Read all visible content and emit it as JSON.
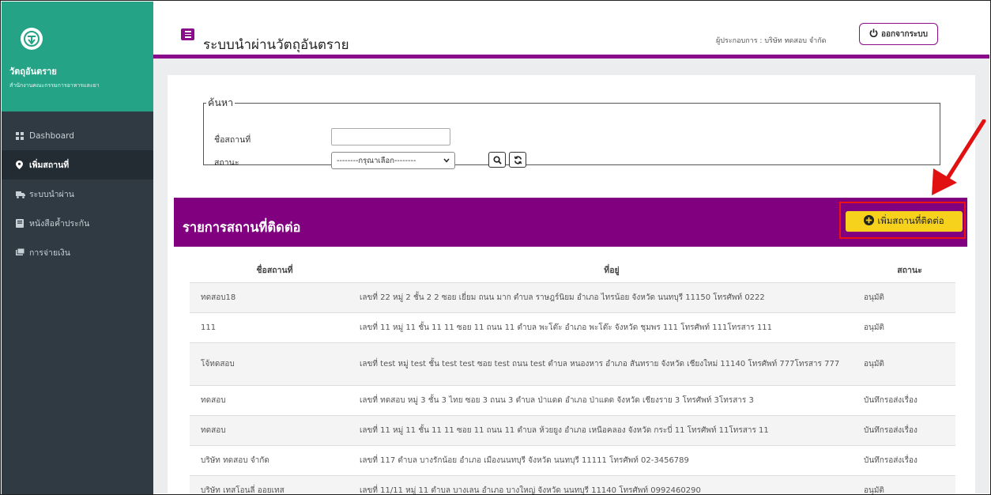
{
  "sidebar": {
    "brand_title": "วัตถุอันตราย",
    "brand_subtitle": "สำนักงานคณะกรรมการอาหารและยา",
    "items": [
      {
        "label": "Dashboard",
        "icon": "dashboard-icon"
      },
      {
        "label": "เพิ่มสถานที่",
        "icon": "map-marker-icon",
        "active": true
      },
      {
        "label": "ระบบนำผ่าน",
        "icon": "truck-icon"
      },
      {
        "label": "หนังสือค้ำประกัน",
        "icon": "book-icon"
      },
      {
        "label": "การจ่ายเงิน",
        "icon": "money-icon"
      }
    ]
  },
  "header": {
    "title": "ระบบนำผ่านวัตถุอันตราย",
    "operator": "ผู้ประกอบการ : บริษัท ทดสอบ จำกัด",
    "logout_label": "ออกจากระบบ"
  },
  "search": {
    "legend": "ค้นหา",
    "name_label": "ชื่อสถานที่",
    "name_value": "",
    "status_label": "สถานะ",
    "status_selected": "--------กรุณาเลือก--------"
  },
  "list": {
    "title": "รายการสถานที่ติดต่อ",
    "add_label": "เพิ่มสถานที่ติดต่อ",
    "columns": [
      "ชื่อสถานที่",
      "ที่อยู่",
      "สถานะ"
    ],
    "rows": [
      {
        "name": "ทดสอบ18",
        "address": "เลขที่ 22 หมู่ 2 ชั้น 2 2 ซอย เยี่ยม ถนน มาก ตำบล ราษฎร์นิยม อำเภอ ไทรน้อย จังหวัด นนทบุรี 11150 โทรศัพท์ 0222",
        "status": "อนุมัติ"
      },
      {
        "name": "111",
        "address": "เลขที่ 11 หมู่ 11 ชั้น 11 11 ซอย 11 ถนน 11 ตำบล พะโต๊ะ อำเภอ พะโต๊ะ จังหวัด ชุมพร 111 โทรศัพท์ 111โทรสาร 111",
        "status": "อนุมัติ"
      },
      {
        "name": "โจ้ทดสอบ",
        "address": "เลขที่ test หมู่ test ชั้น test test ซอย test ถนน test ตำบล หนองหาร อำเภอ สันทราย จังหวัด เชียงใหม่ 11140 โทรศัพท์ 777โทรสาร 777",
        "status": "อนุมัติ"
      },
      {
        "name": "ทดสอบ",
        "address": "เลขที่ ทดสอบ หมู่ 3 ชั้น 3 ไทย ซอย 3 ถนน 3 ตำบล ป่าแดด อำเภอ ป่าแดด จังหวัด เชียงราย 3 โทรศัพท์ 3โทรสาร 3",
        "status": "บันทึกรอส่งเรื่อง"
      },
      {
        "name": "ทดสอบ",
        "address": "เลขที่ 11 หมู่ 11 ชั้น 11 11 ซอย 11 ถนน 11 ตำบล ห้วยยูง อำเภอ เหนือคลอง จังหวัด กระบี่ 11 โทรศัพท์ 11โทรสาร 11",
        "status": "บันทึกรอส่งเรื่อง"
      },
      {
        "name": "บริษัท ทดสอบ จำกัด",
        "address": "เลขที่ 117 ตำบล บางรักน้อย อำเภอ เมืองนนทบุรี จังหวัด นนทบุรี 11111 โทรศัพท์ 02-3456789",
        "status": "บันทึกรอส่งเรื่อง"
      },
      {
        "name": "บริษัท เทสโอนลี่ ออยเทส",
        "address": "เลขที่ 11/11 หมู่ 11 ตำบล บางเลน อำเภอ บางใหญ่ จังหวัด นนทบุรี 11140 โทรศัพท์ 0992460290",
        "status": "อนุมัติ"
      }
    ]
  },
  "colors": {
    "sidebar_bg": "#2f3a42",
    "brand_bg": "#25a386",
    "accent_purple": "#800080",
    "add_button": "#f6d21d",
    "annotation_red": "#e11111"
  }
}
